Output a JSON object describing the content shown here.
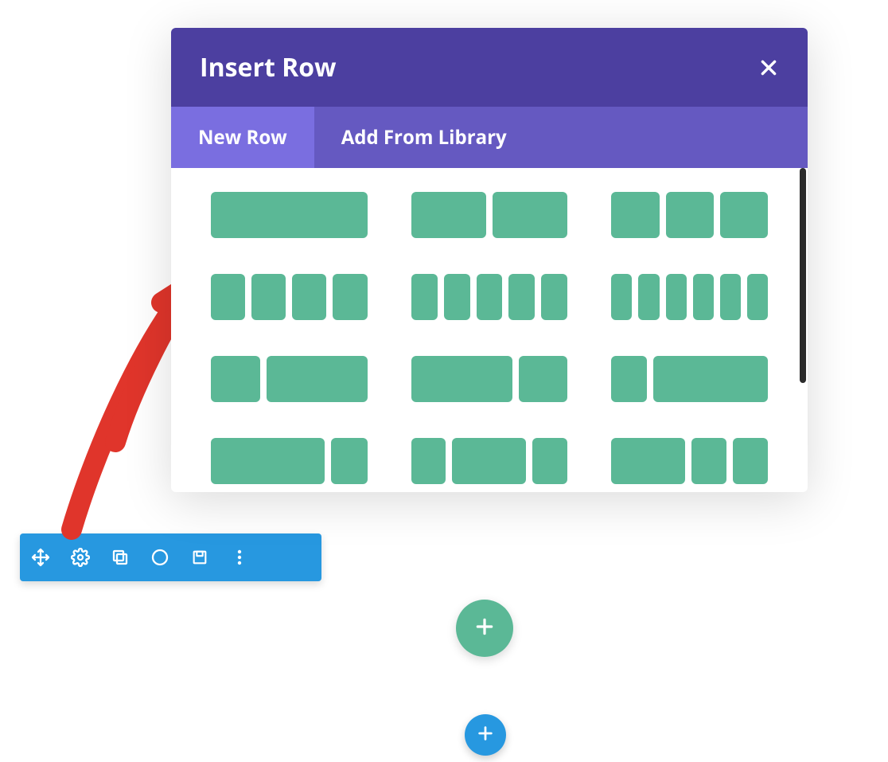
{
  "modal": {
    "title": "Insert Row",
    "close_icon": "close-icon",
    "tabs": [
      {
        "label": "New Row",
        "active": true
      },
      {
        "label": "Add From Library",
        "active": false
      }
    ],
    "layouts": [
      {
        "name": "1-col",
        "cols": [
          100
        ]
      },
      {
        "name": "2-col",
        "cols": [
          50,
          50
        ]
      },
      {
        "name": "3-col",
        "cols": [
          33.33,
          33.33,
          33.33
        ]
      },
      {
        "name": "4-col",
        "cols": [
          25,
          25,
          25,
          25
        ]
      },
      {
        "name": "5-col",
        "cols": [
          20,
          20,
          20,
          20,
          20
        ]
      },
      {
        "name": "6-col",
        "cols": [
          16.66,
          16.66,
          16.66,
          16.66,
          16.66,
          16.66
        ]
      },
      {
        "name": "1-3_2-3",
        "cols": [
          33.33,
          66.67
        ]
      },
      {
        "name": "2-3_1-3",
        "cols": [
          66.67,
          33.33
        ]
      },
      {
        "name": "1-4_3-4",
        "cols": [
          25,
          75
        ]
      },
      {
        "name": "3-4_1-4",
        "cols": [
          75,
          25
        ]
      },
      {
        "name": "1-4_1-2_1-4",
        "cols": [
          25,
          50,
          25
        ]
      },
      {
        "name": "1-2_1-4_1-4",
        "cols": [
          50,
          25,
          25
        ]
      }
    ]
  },
  "toolbar": {
    "icons": [
      "move-icon",
      "gear-icon",
      "duplicate-icon",
      "color-icon",
      "save-icon",
      "menu-icon"
    ]
  },
  "add_row_icon": "plus-icon",
  "add_section_icon": "plus-icon",
  "colors": {
    "purple_dark": "#4c3fa0",
    "purple_mid": "#6559c1",
    "purple_light": "#7a6ee0",
    "teal": "#5bb896",
    "blue": "#2798e0",
    "annotation_red": "#e0352b"
  }
}
